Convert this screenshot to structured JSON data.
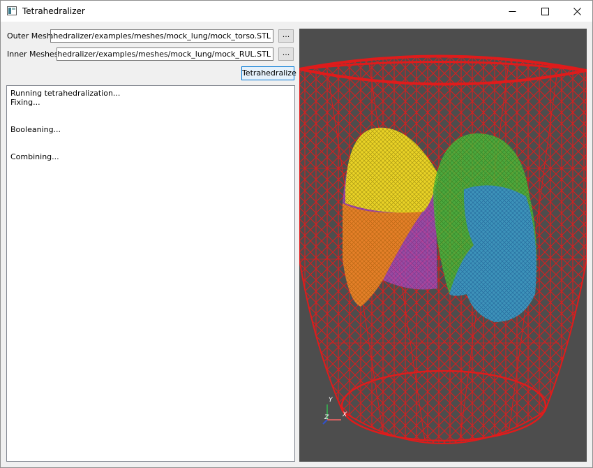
{
  "window": {
    "title": "Tetrahedralizer",
    "icon": "app-icon",
    "controls": [
      "minimize-icon",
      "maximize-icon",
      "close-icon"
    ]
  },
  "form": {
    "outer_label": "Outer Mesh",
    "outer_path": "hub/tetrahedralizer/examples/meshes/mock_lung/mock_torso.STL",
    "inner_label": "Inner Meshes",
    "inner_path": "ub/tetrahedralizer/examples/meshes/mock_lung/mock_RUL.STL",
    "browse_label": "...",
    "tetrahedralize_label": "Tetrahedralize"
  },
  "log": {
    "text": "Running tetrahedralization...\nFixing...\n\n\nBooleaning...\n\n\nCombining..."
  },
  "viewport": {
    "background": "#4d4d4d",
    "mesh_colors": {
      "torso": "#e01b1b",
      "upper_left_lobe": "#f2e21a",
      "middle_left_lobe": "#f08a14",
      "lower_left_lobe": "#b04cc0",
      "upper_right_lobe": "#4cbf3a",
      "lower_right_lobe": "#3a8fd0"
    },
    "axes": {
      "y_label": "Y",
      "x_label": "X",
      "z_label": "Z"
    }
  }
}
